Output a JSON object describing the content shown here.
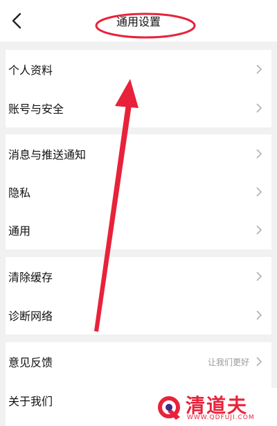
{
  "header": {
    "title": "通用设置",
    "back_icon": "chevron-left-icon"
  },
  "groups": [
    {
      "items": [
        {
          "label": "个人资料"
        },
        {
          "label": "账号与安全"
        }
      ]
    },
    {
      "items": [
        {
          "label": "消息与推送通知"
        },
        {
          "label": "隐私"
        },
        {
          "label": "通用"
        }
      ]
    },
    {
      "items": [
        {
          "label": "清除缓存"
        },
        {
          "label": "诊断网络"
        }
      ]
    },
    {
      "items": [
        {
          "label": "意见反馈",
          "hint": "让我们更好"
        },
        {
          "label": "关于我们"
        }
      ]
    }
  ],
  "annotation": {
    "color": "#e8223a"
  },
  "watermark": {
    "name": "清道夫",
    "url": "WWW.QDFUJI.COM"
  },
  "colors": {
    "background": "#f1f1f1",
    "card": "#ffffff",
    "chevron": "#b0b0b0",
    "hint": "#9a9a9a"
  }
}
